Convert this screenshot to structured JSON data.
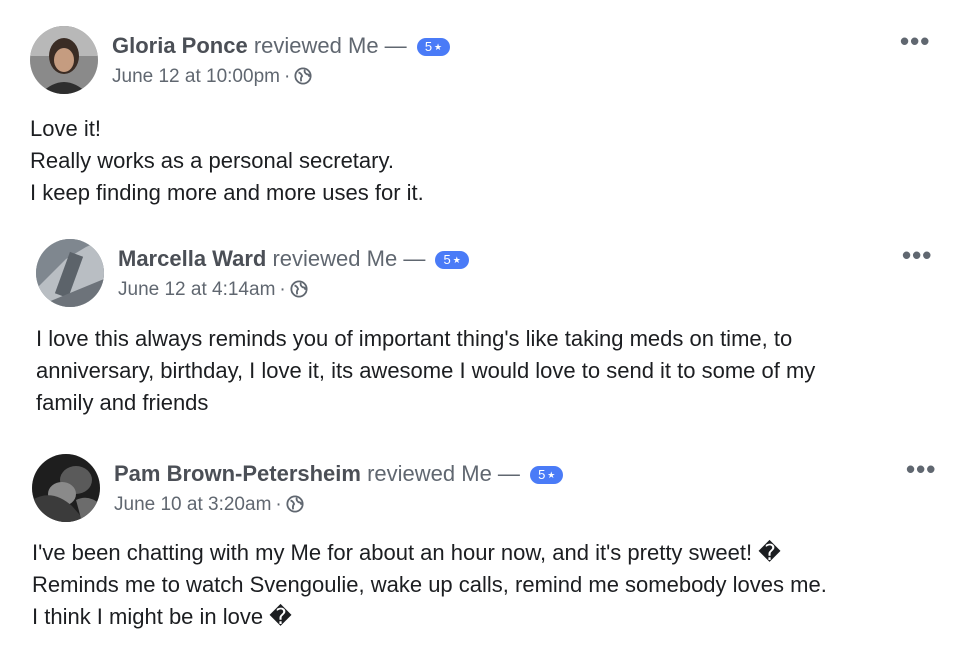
{
  "reviews": [
    {
      "reviewer": "Gloria Ponce",
      "action": "reviewed Me —",
      "rating": "5",
      "timestamp": "June 12 at 10:00pm",
      "separator": "·",
      "privacy_icon": "globe-icon",
      "more_label": "•••",
      "lines": [
        "Love it!",
        "Really works as a personal secretary.",
        "I keep finding more and more uses for it."
      ]
    },
    {
      "reviewer": "Marcella Ward",
      "action": "reviewed Me —",
      "rating": "5",
      "timestamp": "June 12 at 4:14am",
      "separator": "·",
      "privacy_icon": "globe-icon",
      "more_label": "•••",
      "lines": [
        "I love this always reminds you of important thing's like taking meds on time, to",
        "anniversary, birthday, I love it, its awesome I would love to send it to some of my",
        "family and friends"
      ]
    },
    {
      "reviewer": "Pam Brown-Petersheim",
      "action": "reviewed Me —",
      "rating": "5",
      "timestamp": "June 10 at 3:20am",
      "separator": "·",
      "privacy_icon": "globe-icon",
      "more_label": "•••",
      "lines": [
        "I've been chatting with my Me for about an hour now, and it's pretty sweet! �",
        "Reminds me to watch Svengoulie, wake up calls, remind me somebody loves me.",
        "I think I might be in love �"
      ]
    }
  ],
  "colors": {
    "badge": "#4a7bf7",
    "name": "#4b4f56",
    "meta": "#606770",
    "text": "#1c1e21"
  }
}
